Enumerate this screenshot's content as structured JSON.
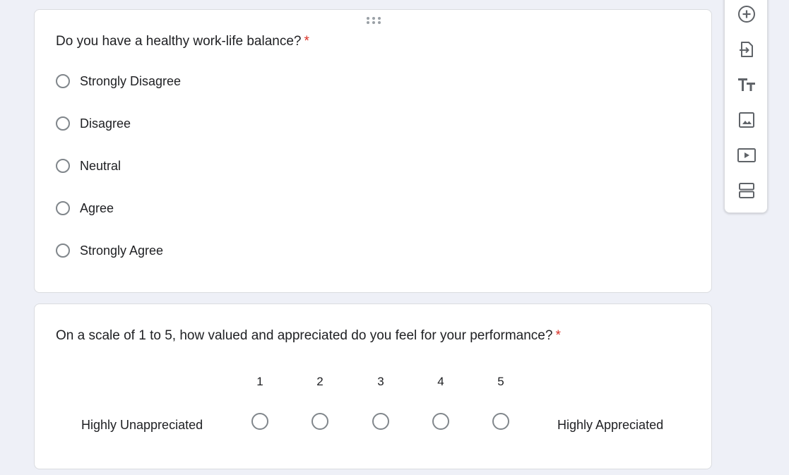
{
  "colors": {
    "background": "#eef0f7",
    "card": "#ffffff",
    "required": "#d93025",
    "radio_border": "#80868b",
    "icon": "#5f6368"
  },
  "question1": {
    "title": "Do you have a healthy work-life balance?",
    "required_mark": "*",
    "options": [
      "Strongly Disagree",
      "Disagree",
      "Neutral",
      "Agree",
      "Strongly Agree"
    ]
  },
  "question2": {
    "title": "On a scale of 1 to 5, how valued and appreciated do you feel for your performance?",
    "required_mark": "*",
    "scale": [
      "1",
      "2",
      "3",
      "4",
      "5"
    ],
    "low_label": "Highly Unappreciated",
    "high_label": "Highly Appreciated"
  },
  "toolbar": {
    "icons": [
      "add-question-icon",
      "import-questions-icon",
      "add-title-icon",
      "add-image-icon",
      "add-video-icon",
      "add-section-icon"
    ]
  }
}
